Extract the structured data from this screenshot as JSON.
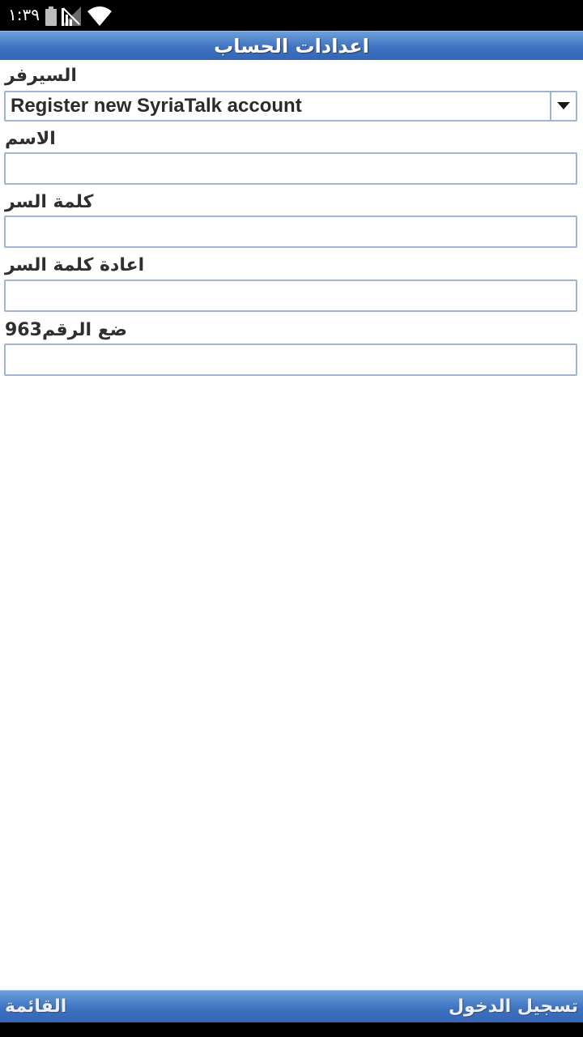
{
  "status_bar": {
    "time": "١:٣٩",
    "battery_icon": "battery-icon",
    "signal_icon": "no-signal-icon",
    "wifi_icon": "wifi-icon"
  },
  "header": {
    "title": "اعدادات الحساب"
  },
  "form": {
    "server": {
      "label": "السيرفر",
      "selected_value": "Register new SyriaTalk account"
    },
    "name": {
      "label": "الاسم",
      "value": ""
    },
    "password": {
      "label": "كلمة السر",
      "value": ""
    },
    "confirm_password": {
      "label": "اعادة كلمة السر",
      "value": ""
    },
    "phone": {
      "label": "ضع الرقم963",
      "value": ""
    }
  },
  "softkeys": {
    "left": "القائمة",
    "right": "تسجيل الدخول"
  },
  "colors": {
    "bar_blue": "#3d73c2",
    "input_border": "#9fb4d0"
  }
}
